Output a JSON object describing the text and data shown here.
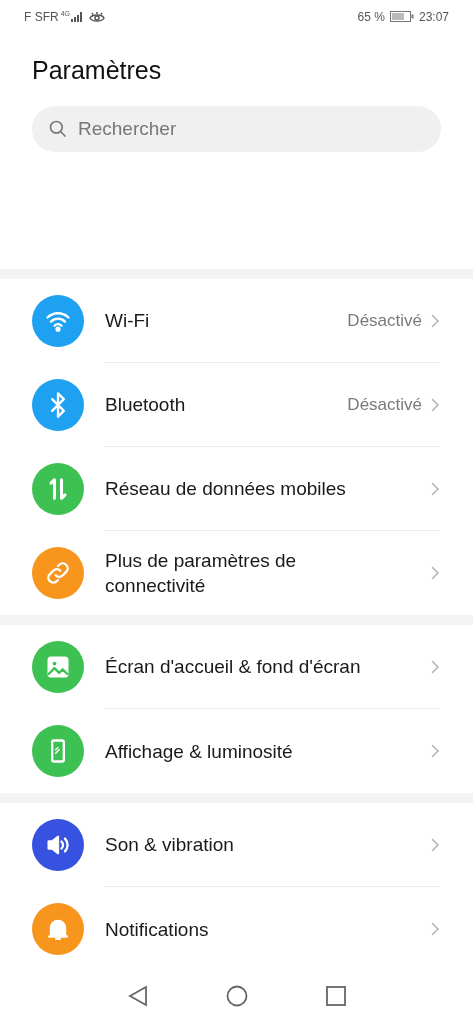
{
  "status_bar": {
    "carrier": "F SFR",
    "network": "4G",
    "battery": "65 %",
    "time": "23:07"
  },
  "title": "Paramètres",
  "search": {
    "placeholder": "Rechercher"
  },
  "groups": [
    {
      "items": [
        {
          "kind": "wifi",
          "color": "#1ea1f1",
          "label": "Wi-Fi",
          "value": "Désactivé"
        },
        {
          "kind": "bluetooth",
          "color": "#1ea1f1",
          "label": "Bluetooth",
          "value": "Désactivé"
        },
        {
          "kind": "data",
          "color": "#3cc152",
          "label": "Réseau de données mobiles"
        },
        {
          "kind": "link",
          "color": "#f7951d",
          "label": "Plus de paramètres de connectivité"
        }
      ]
    },
    {
      "items": [
        {
          "kind": "image",
          "color": "#3cc152",
          "label": "Écran d'accueil & fond d'écran"
        },
        {
          "kind": "phone",
          "color": "#3cc152",
          "label": "Affichage & luminosité"
        }
      ]
    },
    {
      "items": [
        {
          "kind": "sound",
          "color": "#3751e0",
          "label": "Son & vibration"
        },
        {
          "kind": "bell",
          "color": "#f7951d",
          "label": "Notifications"
        }
      ]
    }
  ]
}
